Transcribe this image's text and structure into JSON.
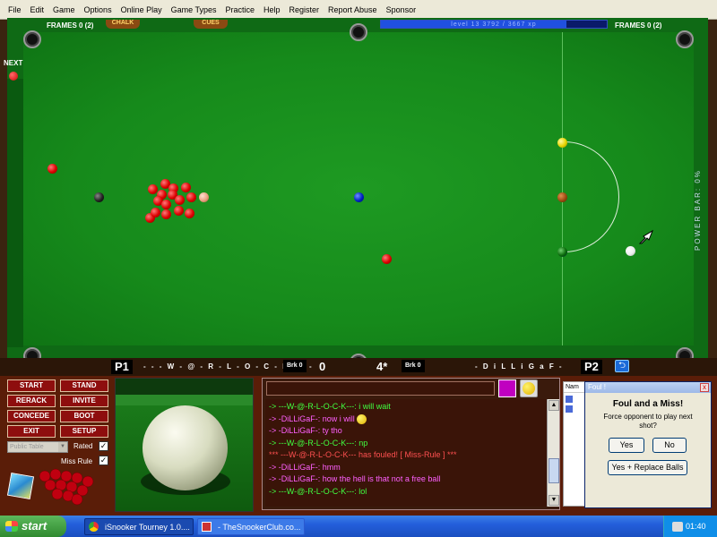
{
  "menu": [
    "File",
    "Edit",
    "Game",
    "Options",
    "Online Play",
    "Game Types",
    "Practice",
    "Help",
    "Register",
    "Report Abuse",
    "Sponsor"
  ],
  "top": {
    "frames_left": "FRAMES  0  (2)",
    "frames_right": "FRAMES  0  (2)",
    "chalk": "CHALK",
    "cues": "CUES",
    "xp_text": "level 13   3792 / 3667 xp",
    "xp_progress": 0.82
  },
  "next_label": "NEXT",
  "power_bar": "POWER BAR: 0%",
  "score": {
    "p1": "P1",
    "p1_name": "- - - W - @ - R - L - O - C - K - - -",
    "p1_brk_label": "Brk",
    "p1_brk": "0",
    "p1_score": "0",
    "mid_score": "4*",
    "p2_brk_label": "Brk",
    "p2_brk": "0",
    "p2_name": "- D i L L i G a F -",
    "p2": "P2",
    "arrow": "⮌"
  },
  "buttons": {
    "start": "START",
    "stand": "STAND",
    "rerack": "RERACK",
    "invite": "INVITE",
    "concede": "CONCEDE",
    "boot": "BOOT",
    "exit": "EXIT",
    "setup": "SETUP"
  },
  "table_select": "Public Table",
  "rated_label": "Rated",
  "miss_rule_label": "Miss Rule",
  "chat": [
    {
      "text": "-> ---W-@-R-L-O-C-K---: i will wait",
      "color": "#40ff40"
    },
    {
      "text": "-> -DiLLiGaF-: now i will",
      "color": "#ff60ff"
    },
    {
      "text": "-> -DiLLiGaF-: ty tho",
      "color": "#ff60ff"
    },
    {
      "text": "-> ---W-@-R-L-O-C-K---: np",
      "color": "#40ff40"
    },
    {
      "text": "*** ---W-@-R-L-O-C-K--- has fouled! [ Miss-Rule ] ***",
      "color": "#ff5050"
    },
    {
      "text": "-> -DiLLiGaF-: hmm",
      "color": "#ff60ff"
    },
    {
      "text": "-> -DiLLiGaF-: how the hell is that not a free ball",
      "color": "#ff60ff"
    },
    {
      "text": "-> ---W-@-R-L-O-C-K---: lol",
      "color": "#40ff40"
    }
  ],
  "userlist_header": "Nam",
  "dialog": {
    "title": "Foul !",
    "close": "x",
    "heading": "Foul and a Miss!",
    "message": "Force opponent to play next shot?",
    "yes": "Yes",
    "no": "No",
    "replace": "Yes + Replace Balls"
  },
  "taskbar": {
    "start": "start",
    "task1": "iSnooker Tourney 1.0....",
    "task2": "- TheSnookerClub.co...",
    "clock": "01:40"
  }
}
